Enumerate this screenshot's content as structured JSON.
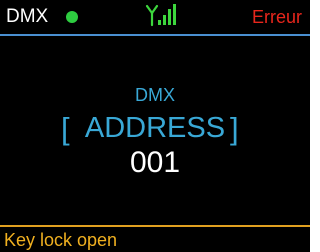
{
  "status_bar": {
    "mode_label": "DMX",
    "signal_icon": "antenna-signal-icon",
    "error_text": "Erreur"
  },
  "main": {
    "menu_title": "DMX",
    "bracket_left": "[",
    "parameter_name": "ADDRESS",
    "bracket_right": "]",
    "parameter_value": "001"
  },
  "footer": {
    "message": "Key lock open"
  },
  "colors": {
    "background": "#000000",
    "status_dot": "#2ecc40",
    "signal": "#3dd63d",
    "error": "#e8261c",
    "divider_top": "#4a8fd0",
    "divider_bottom": "#e0a020",
    "accent_cyan": "#39a8d6",
    "footer_text": "#f0b020",
    "text_white": "#ffffff"
  }
}
